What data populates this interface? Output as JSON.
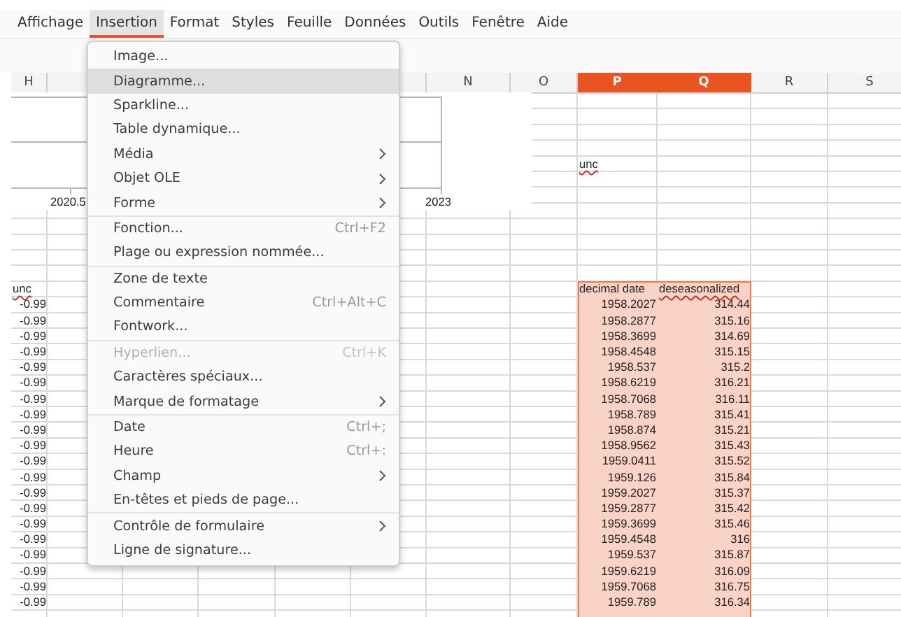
{
  "menubar": [
    {
      "label": "Affichage",
      "selected": false
    },
    {
      "label": "Insertion",
      "selected": true
    },
    {
      "label": "Format",
      "selected": false
    },
    {
      "label": "Styles",
      "selected": false
    },
    {
      "label": "Feuille",
      "selected": false
    },
    {
      "label": "Données",
      "selected": false
    },
    {
      "label": "Outils",
      "selected": false
    },
    {
      "label": "Fenêtre",
      "selected": false
    },
    {
      "label": "Aide",
      "selected": false
    }
  ],
  "sheet": {
    "columns": [
      {
        "label": "H",
        "selected": false
      },
      {},
      {},
      {},
      {},
      {},
      {
        "label": "N",
        "selected": false
      },
      {
        "label": "O",
        "selected": false
      },
      {
        "label": "P",
        "selected": true
      },
      {
        "label": "Q",
        "selected": true
      },
      {
        "label": "R",
        "selected": false
      },
      {
        "label": "S",
        "selected": false
      }
    ],
    "chart": {
      "axis_labels": [
        "2020.5",
        "2023"
      ]
    },
    "rows": [
      {},
      {},
      {},
      {},
      {
        "col_p": "unc"
      },
      {},
      {},
      {},
      {},
      {},
      {},
      {},
      {
        "col_h": "unc",
        "col_p": "decimal date",
        "col_q": "deseasonalized"
      },
      {
        "col_h": "-0.99",
        "col_p": "1958.2027",
        "col_q": "314.44"
      },
      {
        "col_h": "-0.99",
        "col_p": "1958.2877",
        "col_q": "315.16"
      },
      {
        "col_h": "-0.99",
        "col_p": "1958.3699",
        "col_q": "314.69"
      },
      {
        "col_h": "-0.99",
        "col_p": "1958.4548",
        "col_q": "315.15"
      },
      {
        "col_h": "-0.99",
        "col_p": "1958.537",
        "col_q": "315.2"
      },
      {
        "col_h": "-0.99",
        "col_p": "1958.6219",
        "col_q": "316.21"
      },
      {
        "col_h": "-0.99",
        "col_p": "1958.7068",
        "col_q": "316.11"
      },
      {
        "col_h": "-0.99",
        "col_p": "1958.789",
        "col_q": "315.41"
      },
      {
        "col_h": "-0.99",
        "col_p": "1958.874",
        "col_q": "315.21"
      },
      {
        "col_h": "-0.99",
        "col_p": "1958.9562",
        "col_q": "315.43"
      },
      {
        "col_h": "-0.99",
        "col_p": "1959.0411",
        "col_q": "315.52"
      },
      {
        "col_h": "-0.99",
        "col_p": "1959.126",
        "col_q": "315.84"
      },
      {
        "col_h": "-0.99",
        "col_p": "1959.2027",
        "col_q": "315.37"
      },
      {
        "col_h": "-0.99",
        "col_p": "1959.2877",
        "col_q": "315.42"
      },
      {
        "col_h": "-0.99",
        "col_p": "1959.3699",
        "col_q": "315.46"
      },
      {
        "col_h": "-0.99",
        "col_p": "1959.4548",
        "col_q": "316"
      },
      {
        "col_h": "-0.99",
        "col_p": "1959.537",
        "col_q": "315.87"
      },
      {
        "col_h": "-0.99",
        "col_p": "1959.6219",
        "col_q": "316.09"
      },
      {
        "col_h": "-0.99",
        "col_p": "1959.7068",
        "col_q": "316.75"
      },
      {
        "col_h": "-0.99",
        "col_p": "1959.789",
        "col_q": "316.34"
      }
    ]
  },
  "menu": {
    "groups": [
      [
        {
          "label": "Image...",
          "selected": false,
          "disabled": false
        },
        {
          "label": "Diagramme...",
          "selected": true,
          "disabled": false
        },
        {
          "label": "Sparkline...",
          "selected": false,
          "disabled": false
        },
        {
          "label": "Table dynamique...",
          "selected": false,
          "disabled": false
        },
        {
          "label": "Média",
          "submenu": true,
          "selected": false,
          "disabled": false
        },
        {
          "label": "Objet OLE",
          "submenu": true,
          "selected": false,
          "disabled": false
        },
        {
          "label": "Forme",
          "submenu": true,
          "selected": false,
          "disabled": false
        }
      ],
      [
        {
          "label": "Fonction...",
          "shortcut": "Ctrl+F2",
          "selected": false,
          "disabled": false
        },
        {
          "label": "Plage ou expression nommée...",
          "selected": false,
          "disabled": false
        }
      ],
      [
        {
          "label": "Zone de texte",
          "selected": false,
          "disabled": false
        },
        {
          "label": "Commentaire",
          "shortcut": "Ctrl+Alt+C",
          "selected": false,
          "disabled": false
        },
        {
          "label": "Fontwork...",
          "selected": false,
          "disabled": false
        }
      ],
      [
        {
          "label": "Hyperlien...",
          "shortcut": "Ctrl+K",
          "selected": false,
          "disabled": true
        },
        {
          "label": "Caractères spéciaux...",
          "selected": false,
          "disabled": false
        },
        {
          "label": "Marque de formatage",
          "submenu": true,
          "selected": false,
          "disabled": false
        }
      ],
      [
        {
          "label": "Date",
          "shortcut": "Ctrl+;",
          "selected": false,
          "disabled": false
        },
        {
          "label": "Heure",
          "shortcut": "Ctrl+:",
          "selected": false,
          "disabled": false
        },
        {
          "label": "Champ",
          "submenu": true,
          "selected": false,
          "disabled": false
        },
        {
          "label": "En-têtes et pieds de page...",
          "selected": false,
          "disabled": false
        }
      ],
      [
        {
          "label": "Contrôle de formulaire",
          "submenu": true,
          "selected": false,
          "disabled": false
        },
        {
          "label": "Ligne de signature...",
          "selected": false,
          "disabled": false
        }
      ]
    ]
  }
}
